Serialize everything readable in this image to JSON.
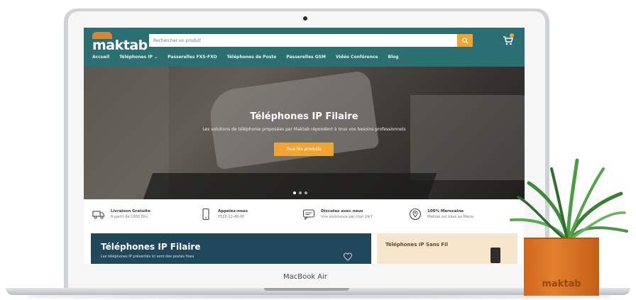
{
  "device": {
    "model_label": "MacBook Air"
  },
  "site": {
    "logo": "maktab",
    "search": {
      "placeholder": "Rechercher un produit"
    },
    "nav": [
      "Accueil",
      "Téléphones IP ⌄",
      "Passerelles FXS-FXO",
      "Téléphones de Poste",
      "Passerelles GSM",
      "Vidéo Conférence",
      "Blog"
    ],
    "hero": {
      "title": "Téléphones IP Filaire",
      "subtitle": "Les solutions de téléphonie proposées par Maktab répondent à tous vos besoins professionnels",
      "cta": "Tous les produits"
    },
    "features": [
      {
        "icon": "truck-icon",
        "title": "Livraison Gratuite",
        "subtitle": "A partir de 1000 Dhs"
      },
      {
        "icon": "phone-icon",
        "title": "Appelez-nous",
        "subtitle": "0520-12-48-00"
      },
      {
        "icon": "chat-icon",
        "title": "Discutez avec nous",
        "subtitle": "Une assistance par chat 24/7"
      },
      {
        "icon": "location-icon",
        "title": "100% Marocaine",
        "subtitle": "Maktab est basé au Maroc"
      }
    ],
    "cards": {
      "left": {
        "title": "Téléphones IP Filaire",
        "subtitle": "Les téléphones IP présentés ici sont des postes fixes"
      },
      "right": {
        "title": "Téléphones IP Sans Fil"
      }
    }
  },
  "decor": {
    "pot_label": "maktab"
  },
  "colors": {
    "header": "#2c6f73",
    "accent": "#f0a434",
    "card_dark": "#21485a",
    "card_light": "#f5e6cc",
    "pot": "#e3802f"
  }
}
